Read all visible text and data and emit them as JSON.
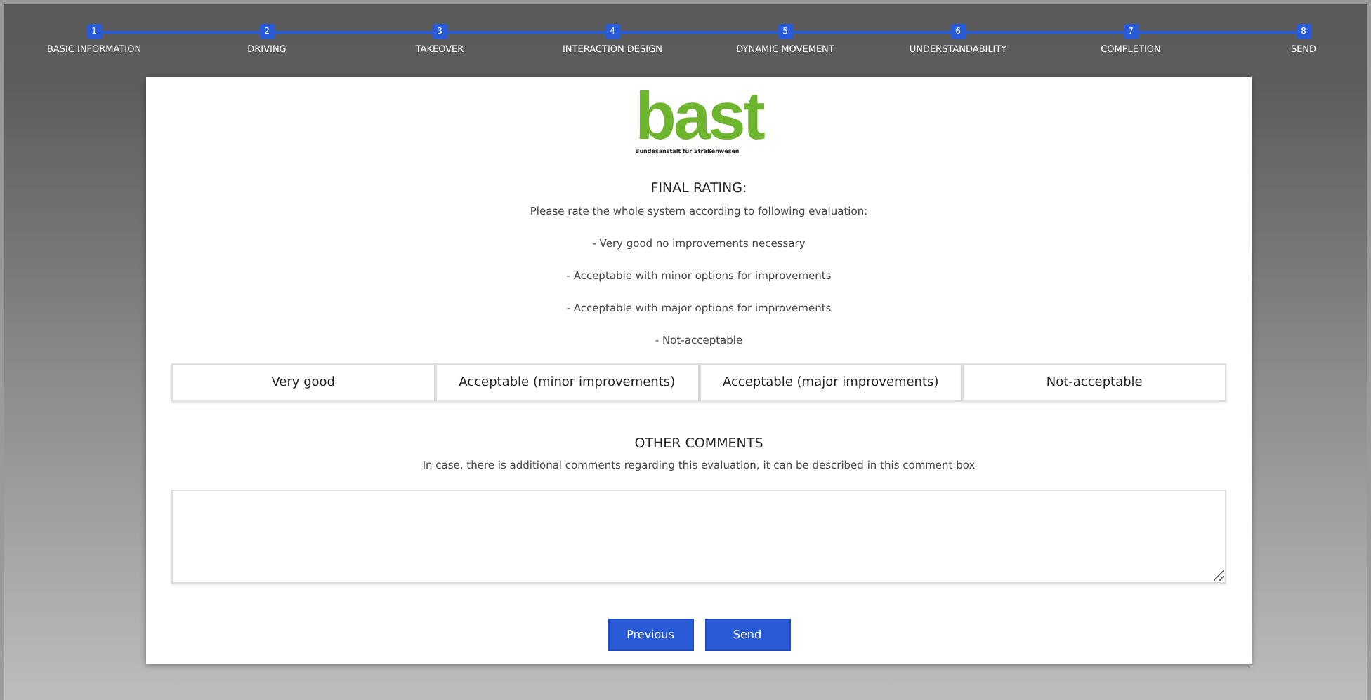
{
  "steps": [
    {
      "number": "1",
      "label": "BASIC INFORMATION"
    },
    {
      "number": "2",
      "label": "DRIVING"
    },
    {
      "number": "3",
      "label": "TAKEOVER"
    },
    {
      "number": "4",
      "label": "INTERACTION DESIGN"
    },
    {
      "number": "5",
      "label": "DYNAMIC MOVEMENT"
    },
    {
      "number": "6",
      "label": "UNDERSTANDABILITY"
    },
    {
      "number": "7",
      "label": "COMPLETION"
    },
    {
      "number": "8",
      "label": "SEND"
    }
  ],
  "logo": {
    "wordmark": "bast",
    "subtitle": "Bundesanstalt für Straßenwesen"
  },
  "rating": {
    "title": "FINAL RATING:",
    "intro": "Please rate the whole system according to following evaluation:",
    "criteria": [
      "- Very good no improvements necessary",
      "- Acceptable with minor options for improvements",
      "- Acceptable with major options for improvements",
      "- Not-acceptable"
    ],
    "options": [
      {
        "label": "Very good",
        "selected": false
      },
      {
        "label": "Acceptable (minor improvements)",
        "selected": false
      },
      {
        "label": "Acceptable (major improvements)",
        "selected": false
      },
      {
        "label": "Not-acceptable",
        "selected": false
      }
    ]
  },
  "comments": {
    "title": "OTHER COMMENTS",
    "hint": "In case, there is additional comments regarding this evaluation, it can be described in this comment box"
  },
  "buttons": [
    "Previous",
    "Send"
  ]
}
